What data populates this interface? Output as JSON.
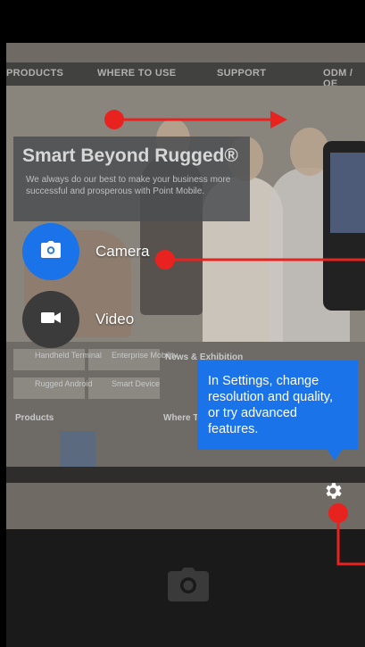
{
  "preview": {
    "nav_items": [
      "PRODUCTS",
      "WHERE TO USE",
      "SUPPORT",
      "ODM / OE"
    ],
    "headline": "Smart Beyond Rugged®",
    "subline": "We always do our best to make your business more successful and prosperous with Point Mobile.",
    "lower_texts": [
      "Handheld Terminal",
      "Enterprise Mobility",
      "Rugged Android",
      "Smart Device",
      "News & Exhibition",
      "Products",
      "Where To"
    ]
  },
  "modes": [
    {
      "label": "Camera",
      "selected": true,
      "icon": "camera-icon"
    },
    {
      "label": "Video",
      "selected": false,
      "icon": "video-icon"
    }
  ],
  "tooltip": {
    "text": "In Settings, change resolution and quality, or try advanced features."
  },
  "controls": {
    "settings_icon": "gear-icon",
    "shutter_icon": "camera-shutter-icon"
  },
  "colors": {
    "accent_blue": "#1a73e8",
    "annotation_red": "#e8231f",
    "mode_bg_inactive": "#3b3b3b"
  }
}
